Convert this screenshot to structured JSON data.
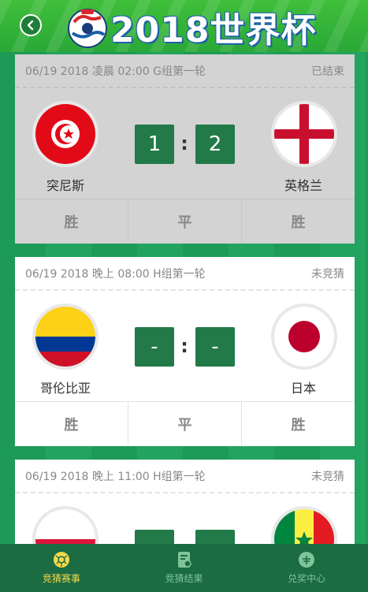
{
  "header": {
    "title": "2018世界杯",
    "back_icon": "chevron-left-icon",
    "logo_icon": "world-cup-ball-icon"
  },
  "matches": [
    {
      "date": "06/19 2018 凌晨 02:00 G组第一轮",
      "status": "已结束",
      "home": {
        "name": "突尼斯",
        "flag": "tunisia-flag-icon"
      },
      "away": {
        "name": "英格兰",
        "flag": "england-flag-icon"
      },
      "home_score": "1",
      "away_score": "2",
      "colon": ":",
      "bets": [
        "胜",
        "平",
        "胜"
      ],
      "ended": true
    },
    {
      "date": "06/19 2018 晚上 08:00 H组第一轮",
      "status": "未竞猜",
      "home": {
        "name": "哥伦比亚",
        "flag": "colombia-flag-icon"
      },
      "away": {
        "name": "日本",
        "flag": "japan-flag-icon"
      },
      "home_score": "-",
      "away_score": "-",
      "colon": ":",
      "bets": [
        "胜",
        "平",
        "胜"
      ],
      "ended": false
    },
    {
      "date": "06/19 2018 晚上 11:00 H组第一轮",
      "status": "未竞猜",
      "home": {
        "name": "",
        "flag": "poland-flag-icon"
      },
      "away": {
        "name": "",
        "flag": "senegal-flag-icon"
      },
      "home_score": "",
      "away_score": "",
      "colon": ":",
      "ended": false
    }
  ],
  "nav": [
    {
      "label": "竞猜赛事",
      "icon": "ball-icon",
      "active": true
    },
    {
      "label": "竞猜结果",
      "icon": "document-icon",
      "active": false
    },
    {
      "label": "兑奖中心",
      "icon": "gift-icon",
      "active": false
    }
  ],
  "colors": {
    "accent": "#217a47",
    "nav_bg": "#1b6b43",
    "nav_active": "#f5d84a"
  }
}
